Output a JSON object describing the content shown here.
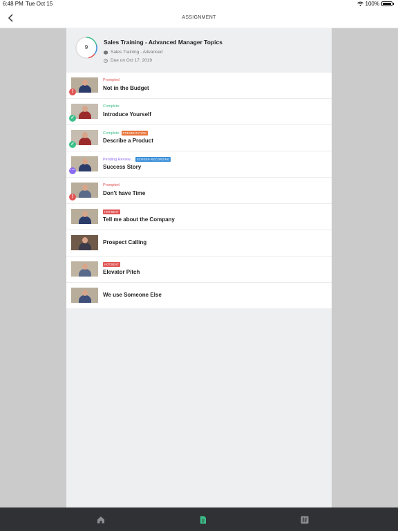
{
  "status_bar": {
    "time": "6:48 PM",
    "date": "Tue Oct 15",
    "battery": "100%"
  },
  "nav": {
    "title": "ASSIGNMENT"
  },
  "assignment": {
    "progress_count": "9",
    "title": "Sales Training - Advanced Manager Topics",
    "category": "Sales Training - Advanced",
    "due": "Due on Oct 17, 2019"
  },
  "colors": {
    "prompted": "#e05555",
    "complete": "#3cbf8a",
    "pending": "#8b6cf0",
    "presentation": "#e8743b",
    "screen_recording": "#3b8fd9",
    "hotseat": "#e05555",
    "tab_active": "#3cbf8a"
  },
  "items": [
    {
      "status": "Prompted",
      "tag": "",
      "name": "Not in the Budget",
      "badge": "!",
      "badge_icon": "alert-icon"
    },
    {
      "status": "Complete",
      "tag": "",
      "name": "Introduce Yourself",
      "badge": "✓",
      "badge_icon": "check-icon"
    },
    {
      "status": "Complete",
      "tag": "PRESENTATION",
      "name": "Describe a Product",
      "badge": "✓",
      "badge_icon": "check-icon"
    },
    {
      "status": "Pending Review...",
      "tag": "SCREEN RECORDING",
      "name": "Success Story",
      "badge": "···",
      "badge_icon": "more-icon"
    },
    {
      "status": "Prompted",
      "tag": "",
      "name": "Don't have Time",
      "badge": "!",
      "badge_icon": "alert-icon"
    },
    {
      "status": "",
      "tag": "HOTSEAT",
      "name": "Tell me about the Company",
      "badge": "",
      "badge_icon": ""
    },
    {
      "status": "",
      "tag": "",
      "name": "Prospect Calling",
      "badge": "",
      "badge_icon": ""
    },
    {
      "status": "",
      "tag": "HOTSEAT",
      "name": "Elevator Pitch",
      "badge": "",
      "badge_icon": ""
    },
    {
      "status": "",
      "tag": "",
      "name": "We use Someone Else",
      "badge": "",
      "badge_icon": ""
    }
  ],
  "tabs": [
    {
      "icon": "home-icon",
      "active": false
    },
    {
      "icon": "document-icon",
      "active": true
    },
    {
      "icon": "hashtag-icon",
      "active": false
    }
  ]
}
